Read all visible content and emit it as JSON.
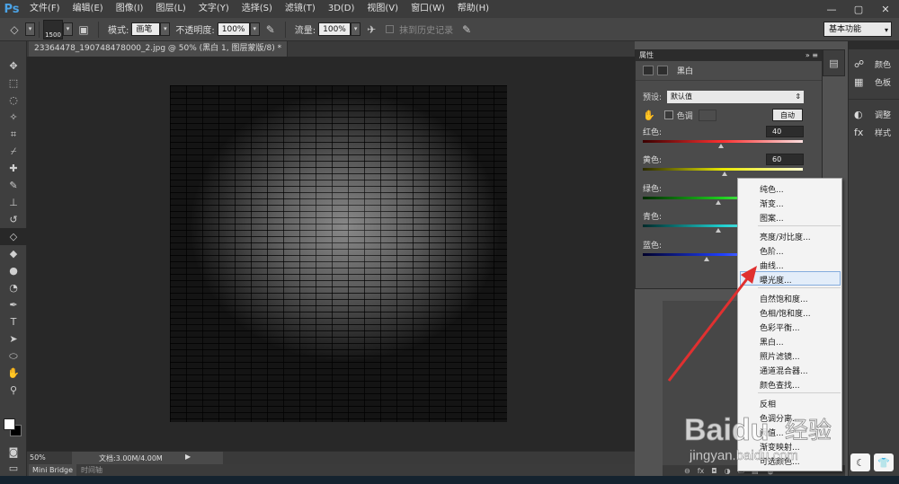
{
  "app": {
    "logo": "Ps"
  },
  "menubar": {
    "items": [
      "文件(F)",
      "编辑(E)",
      "图像(I)",
      "图层(L)",
      "文字(Y)",
      "选择(S)",
      "滤镜(T)",
      "3D(D)",
      "视图(V)",
      "窗口(W)",
      "帮助(H)"
    ]
  },
  "window_controls": {
    "minimize": "—",
    "restore": "▢",
    "close": "✕"
  },
  "options": {
    "brush_size": "1500",
    "mode_label": "模式:",
    "mode_value": "画笔",
    "opacity_label": "不透明度:",
    "opacity_value": "100%",
    "flow_label": "流量:",
    "flow_value": "100%",
    "history_label": "抹到历史记录",
    "workspace": "基本功能"
  },
  "document": {
    "tab_title": "23364478_190748478000_2.jpg @ 50% (黑白 1, 图层蒙版/8) *",
    "zoom": "50%",
    "doc_info": "文档:3.00M/4.00M"
  },
  "bottom_tabs": {
    "bridge": "Mini Bridge",
    "timeline": "时间轴"
  },
  "properties": {
    "title": "属性",
    "type_label": "黑白",
    "preset_label": "预设:",
    "preset_value": "默认值",
    "tint_label": "色调",
    "auto_label": "自动",
    "sliders": [
      {
        "label": "红色:",
        "value": "40",
        "gradient": [
          "#3a0000",
          "#ff3030",
          "#ffe0e0"
        ],
        "level": 0.49
      },
      {
        "label": "黄色:",
        "value": "60",
        "gradient": [
          "#2a2a00",
          "#e8e800",
          "#ffffd0"
        ],
        "level": 0.51
      },
      {
        "label": "绿色:",
        "value": "",
        "gradient": [
          "#002a00",
          "#20d020",
          "#d0ffd0"
        ],
        "level": 0.47
      },
      {
        "label": "青色:",
        "value": "",
        "gradient": [
          "#002a2a",
          "#20d0d0",
          "#d0ffff"
        ],
        "level": 0.47
      },
      {
        "label": "蓝色:",
        "value": "",
        "gradient": [
          "#00002a",
          "#2040ff",
          "#d0d8ff"
        ],
        "level": 0.4
      }
    ]
  },
  "dock": {
    "items": [
      {
        "icon": "☍",
        "label": "颜色"
      },
      {
        "icon": "▦",
        "label": "色板"
      },
      {
        "icon": "◐",
        "label": "调整"
      },
      {
        "icon": "fx",
        "label": "样式"
      }
    ]
  },
  "adjustment_menu": {
    "groups": [
      [
        "纯色...",
        "渐变...",
        "图案..."
      ],
      [
        "亮度/对比度...",
        "色阶...",
        "曲线...",
        "曝光度..."
      ],
      [
        "自然饱和度...",
        "色相/饱和度...",
        "色彩平衡...",
        "黑白...",
        "照片滤镜...",
        "通道混合器...",
        "颜色查找..."
      ],
      [
        "反相",
        "色调分离...",
        "阈值...",
        "渐变映射...",
        "可选颜色..."
      ]
    ],
    "highlighted": "曝光度..."
  },
  "watermark": {
    "brand": "Baidu",
    "brand_cn": "经验",
    "url": "jingyan.baidu.com"
  },
  "colors": {
    "arrow": "#e03030",
    "menu_highlight": "#e3edf9"
  }
}
